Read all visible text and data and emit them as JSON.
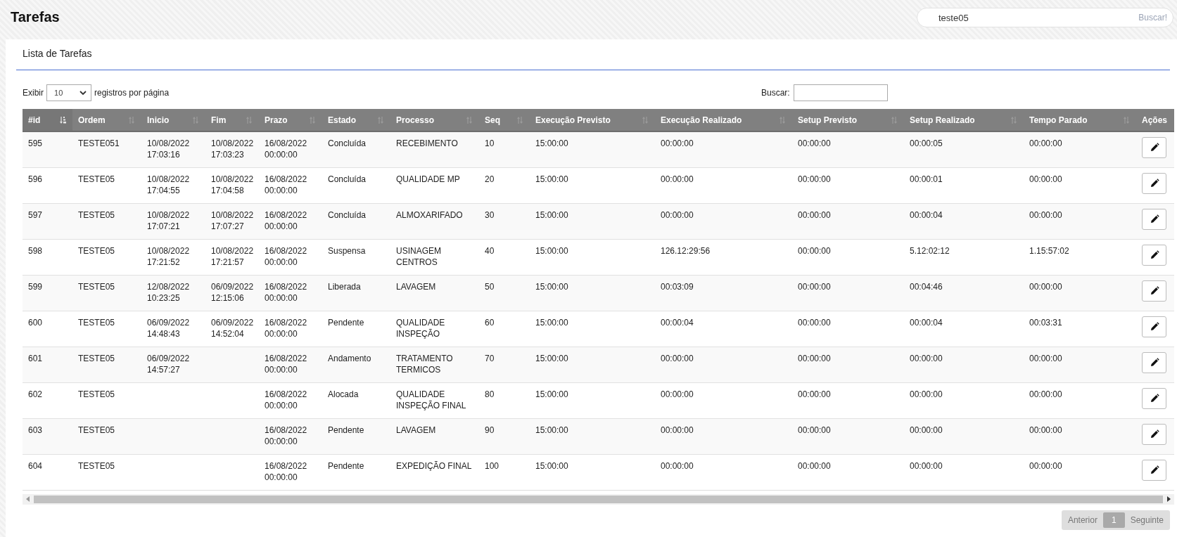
{
  "header": {
    "title": "Tarefas",
    "search": {
      "value": "teste05",
      "button": "Buscar!"
    }
  },
  "panel": {
    "title": "Lista de Tarefas",
    "length_control": {
      "label_before": "Exibir",
      "value": "10",
      "label_after": "registros por página"
    },
    "filter": {
      "label": "Buscar:"
    },
    "table": {
      "columns": [
        {
          "label": "#id",
          "sortable": true,
          "sorted": true
        },
        {
          "label": "Ordem",
          "sortable": true,
          "sorted": false
        },
        {
          "label": "Inicio",
          "sortable": true,
          "sorted": false
        },
        {
          "label": "Fim",
          "sortable": true,
          "sorted": false
        },
        {
          "label": "Prazo",
          "sortable": true,
          "sorted": false
        },
        {
          "label": "Estado",
          "sortable": true,
          "sorted": false
        },
        {
          "label": "Processo",
          "sortable": true,
          "sorted": false
        },
        {
          "label": "Seq",
          "sortable": true,
          "sorted": false
        },
        {
          "label": "Execução Previsto",
          "sortable": true,
          "sorted": false
        },
        {
          "label": "Execução Realizado",
          "sortable": true,
          "sorted": false
        },
        {
          "label": "Setup Previsto",
          "sortable": true,
          "sorted": false
        },
        {
          "label": "Setup Realizado",
          "sortable": true,
          "sorted": false
        },
        {
          "label": "Tempo Parado",
          "sortable": true,
          "sorted": false
        },
        {
          "label": "Ações",
          "sortable": false
        }
      ],
      "rows": [
        {
          "cells": [
            "595",
            "TESTE051",
            "10/08/2022\n17:03:16",
            "10/08/2022\n17:03:23",
            "16/08/2022\n00:00:00",
            "Concluída",
            "RECEBIMENTO",
            "10",
            "15:00:00",
            "00:00:00",
            "00:00:00",
            "00:00:05",
            "00:00:00"
          ]
        },
        {
          "cells": [
            "596",
            "TESTE05",
            "10/08/2022\n17:04:55",
            "10/08/2022\n17:04:58",
            "16/08/2022\n00:00:00",
            "Concluída",
            "QUALIDADE MP",
            "20",
            "15:00:00",
            "00:00:00",
            "00:00:00",
            "00:00:01",
            "00:00:00"
          ]
        },
        {
          "cells": [
            "597",
            "TESTE05",
            "10/08/2022\n17:07:21",
            "10/08/2022\n17:07:27",
            "16/08/2022\n00:00:00",
            "Concluída",
            "ALMOXARIFADO",
            "30",
            "15:00:00",
            "00:00:00",
            "00:00:00",
            "00:00:04",
            "00:00:00"
          ]
        },
        {
          "cells": [
            "598",
            "TESTE05",
            "10/08/2022\n17:21:52",
            "10/08/2022\n17:21:57",
            "16/08/2022\n00:00:00",
            "Suspensa",
            "USINAGEM\nCENTROS",
            "40",
            "15:00:00",
            "126.12:29:56",
            "00:00:00",
            "5.12:02:12",
            "1.15:57:02"
          ]
        },
        {
          "cells": [
            "599",
            "TESTE05",
            "12/08/2022\n10:23:25",
            "06/09/2022\n12:15:06",
            "16/08/2022\n00:00:00",
            "Liberada",
            "LAVAGEM",
            "50",
            "15:00:00",
            "00:03:09",
            "00:00:00",
            "00:04:46",
            "00:00:00"
          ]
        },
        {
          "cells": [
            "600",
            "TESTE05",
            "06/09/2022\n14:48:43",
            "06/09/2022\n14:52:04",
            "16/08/2022\n00:00:00",
            "Pendente",
            "QUALIDADE\nINSPEÇÃO",
            "60",
            "15:00:00",
            "00:00:04",
            "00:00:00",
            "00:00:04",
            "00:03:31"
          ]
        },
        {
          "cells": [
            "601",
            "TESTE05",
            "06/09/2022\n14:57:27",
            "",
            "16/08/2022\n00:00:00",
            "Andamento",
            "TRATAMENTO\nTERMICOS",
            "70",
            "15:00:00",
            "00:00:00",
            "00:00:00",
            "00:00:00",
            "00:00:00"
          ]
        },
        {
          "cells": [
            "602",
            "TESTE05",
            "",
            "",
            "16/08/2022\n00:00:00",
            "Alocada",
            "QUALIDADE\nINSPEÇÃO FINAL",
            "80",
            "15:00:00",
            "00:00:00",
            "00:00:00",
            "00:00:00",
            "00:00:00"
          ]
        },
        {
          "cells": [
            "603",
            "TESTE05",
            "",
            "",
            "16/08/2022\n00:00:00",
            "Pendente",
            "LAVAGEM",
            "90",
            "15:00:00",
            "00:00:00",
            "00:00:00",
            "00:00:00",
            "00:00:00"
          ]
        },
        {
          "cells": [
            "604",
            "TESTE05",
            "",
            "",
            "16/08/2022\n00:00:00",
            "Pendente",
            "EXPEDIÇÃO FINAL",
            "100",
            "15:00:00",
            "00:00:00",
            "00:00:00",
            "00:00:00",
            "00:00:00"
          ]
        }
      ]
    },
    "pagination": {
      "previous": {
        "label": "Anterior",
        "disabled": true
      },
      "pages": [
        {
          "label": "1",
          "selected": true
        }
      ],
      "next": {
        "label": "Seguinte",
        "disabled": true
      }
    }
  }
}
